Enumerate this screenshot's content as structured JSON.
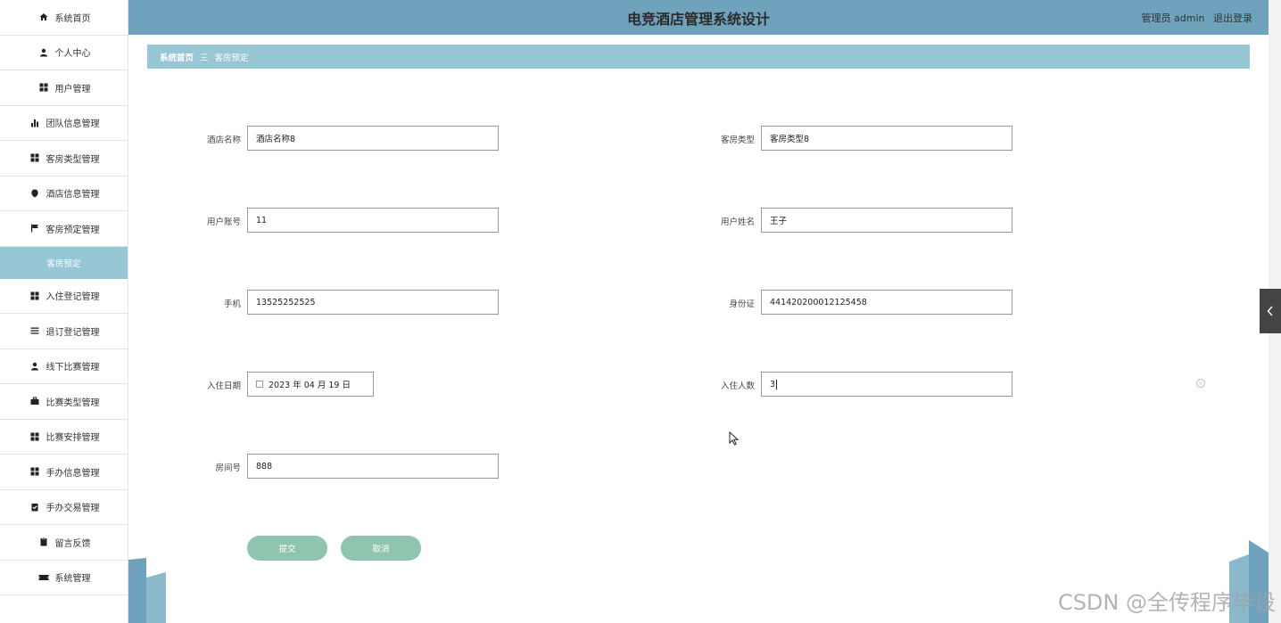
{
  "header": {
    "title": "电竞酒店管理系统设计",
    "user_label": "管理员 admin",
    "logout": "退出登录"
  },
  "sidebar": {
    "items": [
      {
        "label": "系统首页",
        "icon": "home-icon"
      },
      {
        "label": "个人中心",
        "icon": "person-icon"
      },
      {
        "label": "用户管理",
        "icon": "grid-icon"
      },
      {
        "label": "团队信息管理",
        "icon": "bar-chart-icon"
      },
      {
        "label": "客房类型管理",
        "icon": "grid-icon"
      },
      {
        "label": "酒店信息管理",
        "icon": "shield-icon"
      },
      {
        "label": "客房预定管理",
        "icon": "flag-icon"
      },
      {
        "label": "客房预定",
        "icon": ""
      },
      {
        "label": "入住登记管理",
        "icon": "grid-icon"
      },
      {
        "label": "退订登记管理",
        "icon": "list-icon"
      },
      {
        "label": "线下比赛管理",
        "icon": "person-icon"
      },
      {
        "label": "比赛类型管理",
        "icon": "briefcase-icon"
      },
      {
        "label": "比赛安排管理",
        "icon": "grid-icon"
      },
      {
        "label": "手办信息管理",
        "icon": "grid-icon"
      },
      {
        "label": "手办交易管理",
        "icon": "clipboard-check-icon"
      },
      {
        "label": "留言反馈",
        "icon": "clipboard-icon"
      },
      {
        "label": "系统管理",
        "icon": "ticket-icon"
      }
    ]
  },
  "breadcrumb": {
    "home": "系统首页",
    "separator": "三",
    "current": "客房预定"
  },
  "form": {
    "hotel_name": {
      "label": "酒店名称",
      "value": "酒店名称8"
    },
    "room_type": {
      "label": "客房类型",
      "value": "客房类型8"
    },
    "user_account": {
      "label": "用户账号",
      "value": "11"
    },
    "user_name": {
      "label": "用户姓名",
      "value": "王子"
    },
    "phone": {
      "label": "手机",
      "value": "13525252525"
    },
    "id_card": {
      "label": "身份证",
      "value": "441420200012125458"
    },
    "checkin_date": {
      "label": "入住日期",
      "value": "2023 年 04 月 19 日"
    },
    "guests": {
      "label": "入住人数",
      "value": "3"
    },
    "room_no": {
      "label": "房间号",
      "value": "888"
    }
  },
  "buttons": {
    "submit": "提交",
    "cancel": "取消"
  },
  "watermark": "CSDN @全传程序毕设",
  "colors": {
    "header": "#6fa2bd",
    "breadcrumb": "#97c6d5",
    "button": "#8fc4af",
    "active_nav": "#97c6d5"
  }
}
